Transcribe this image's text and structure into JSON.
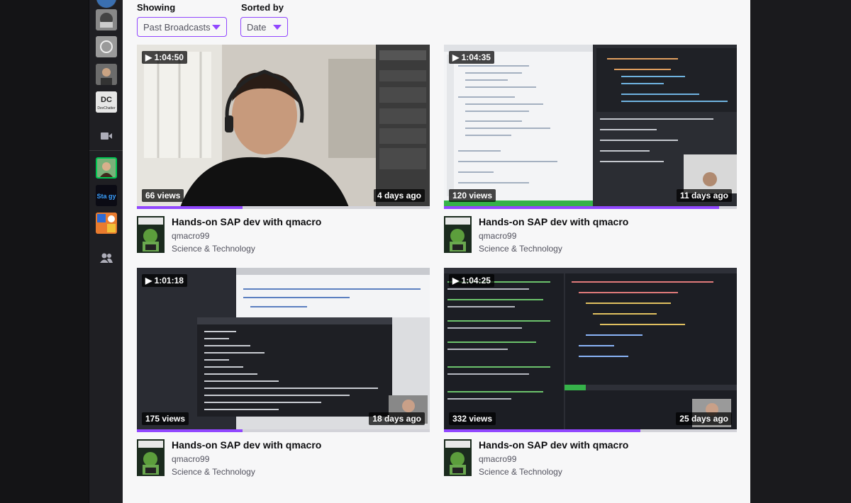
{
  "filters": {
    "showing_label": "Showing",
    "showing_value": "Past Broadcasts",
    "sorted_label": "Sorted by",
    "sorted_value": "Date"
  },
  "sidebar": {
    "items": [
      {
        "name": "channel-avatar-1"
      },
      {
        "name": "channel-avatar-2"
      },
      {
        "name": "channel-avatar-3"
      },
      {
        "name": "channel-avatar-4",
        "label": "DC\nDevChatter"
      },
      {
        "name": "video-camera-icon"
      },
      {
        "name": "channel-avatar-5"
      },
      {
        "name": "channel-avatar-6",
        "label": "Sta gy"
      },
      {
        "name": "channel-avatar-7"
      },
      {
        "name": "friends-icon"
      }
    ]
  },
  "videos": [
    {
      "duration": "1:04:50",
      "views": "66 views",
      "age": "4 days ago",
      "title": "Hands-on SAP dev with qmacro",
      "user": "qmacro99",
      "category": "Science & Technology",
      "progress": 0.36,
      "theme": "webcam"
    },
    {
      "duration": "1:04:35",
      "views": "120 views",
      "age": "11 days ago",
      "title": "Hands-on SAP dev with qmacro",
      "user": "qmacro99",
      "category": "Science & Technology",
      "progress": 0.94,
      "theme": "code-light"
    },
    {
      "duration": "1:01:18",
      "views": "175 views",
      "age": "18 days ago",
      "title": "Hands-on SAP dev with qmacro",
      "user": "qmacro99",
      "category": "Science & Technology",
      "progress": 0.36,
      "theme": "terminal"
    },
    {
      "duration": "1:04:25",
      "views": "332 views",
      "age": "25 days ago",
      "title": "Hands-on SAP dev with qmacro",
      "user": "qmacro99",
      "category": "Science & Technology",
      "progress": 0.67,
      "theme": "code-dark"
    }
  ],
  "colors": {
    "accent": "#9147ff",
    "page_bg": "#f7f7f8",
    "sidebar_bg": "#1f1f23"
  }
}
